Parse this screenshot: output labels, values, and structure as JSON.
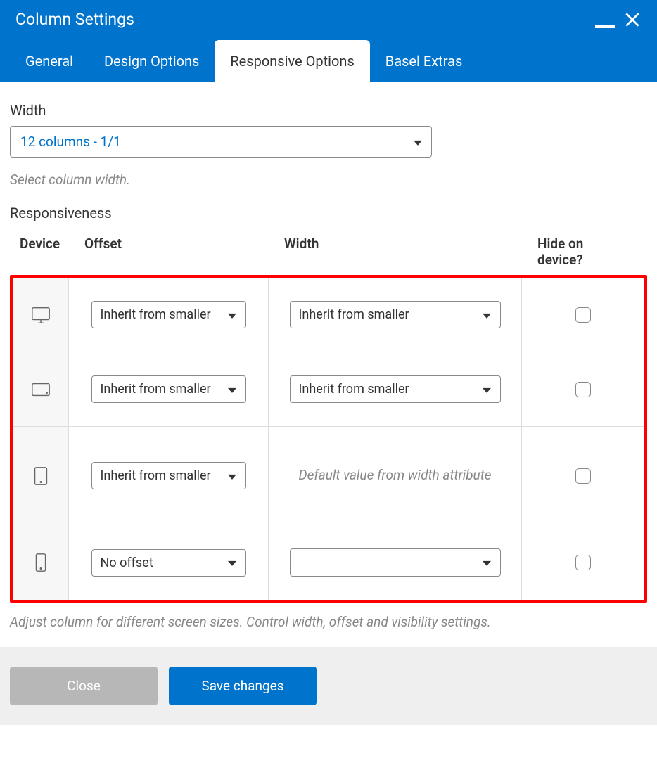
{
  "header": {
    "title": "Column Settings"
  },
  "tabs": [
    {
      "label": "General",
      "active": false
    },
    {
      "label": "Design Options",
      "active": false
    },
    {
      "label": "Responsive Options",
      "active": true
    },
    {
      "label": "Basel Extras",
      "active": false
    }
  ],
  "width_section": {
    "label": "Width",
    "value": "12 columns - 1/1",
    "helper": "Select column width."
  },
  "responsiveness": {
    "label": "Responsiveness",
    "headers": {
      "device": "Device",
      "offset": "Offset",
      "width": "Width",
      "hide": "Hide on device?"
    },
    "rows": [
      {
        "device": "desktop",
        "offset": "Inherit from smaller",
        "width_type": "select",
        "width_value": "Inherit from smaller",
        "hide": false
      },
      {
        "device": "tablet-landscape",
        "offset": "Inherit from smaller",
        "width_type": "select",
        "width_value": "Inherit from smaller",
        "hide": false
      },
      {
        "device": "tablet-portrait",
        "offset": "Inherit from smaller",
        "width_type": "text",
        "width_value": "Default value from width attribute",
        "hide": false
      },
      {
        "device": "phone",
        "offset": "No offset",
        "width_type": "select",
        "width_value": "",
        "hide": false
      }
    ],
    "helper": "Adjust column for different screen sizes. Control width, offset and visibility settings."
  },
  "footer": {
    "close": "Close",
    "save": "Save changes"
  }
}
